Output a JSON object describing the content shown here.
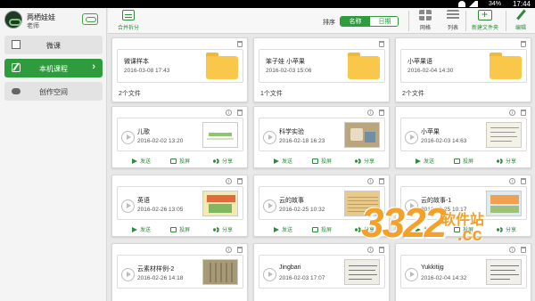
{
  "status_bar": {
    "battery": "34%",
    "time": "17:44"
  },
  "profile": {
    "name": "两栖娃娃",
    "role": "老师"
  },
  "sidebar": {
    "items": [
      {
        "label": "微课",
        "icon": "document-icon",
        "active": false
      },
      {
        "label": "本机课程",
        "icon": "pen-icon",
        "active": true
      },
      {
        "label": "创作空间",
        "icon": "cloud-icon",
        "active": false
      }
    ]
  },
  "toolbar": {
    "merge_label": "合并拆分",
    "sort_label": "排序",
    "sort_options": [
      "名称",
      "日期"
    ],
    "sort_selected": "名称",
    "grid_label": "网格",
    "list_label": "列表",
    "new_folder_label": "新建文件夹",
    "edit_label": "编辑",
    "accent_color": "#2e9b3c"
  },
  "actions": {
    "send": "发送",
    "project": "投屏",
    "share": "分享"
  },
  "folders": [
    {
      "name": "微课样本",
      "date": "2016-03-08 17:43",
      "count": "2个文件"
    },
    {
      "name": "笨子娃 小苹果",
      "date": "2016-02-03 15:06",
      "count": "1个文件"
    },
    {
      "name": "小苹果语",
      "date": "2016-02-04 14:30",
      "count": "2个文件"
    }
  ],
  "files": [
    {
      "name": "儿歌",
      "date": "2016-02-02 13:20"
    },
    {
      "name": "科学实验",
      "date": "2016-02-18 16:23"
    },
    {
      "name": "小苹果",
      "date": "2016-02-03 14:63"
    },
    {
      "name": "英语",
      "date": "2016-02-26 13:05"
    },
    {
      "name": "云的故事",
      "date": "2016-02-25 10:32"
    },
    {
      "name": "云的故事-1",
      "date": "2016-02-25 10:17"
    },
    {
      "name": "云素材样例-2",
      "date": "2016-02-26 14:18"
    },
    {
      "name": "Jingbari",
      "date": "2016-02-03 17:07"
    },
    {
      "name": "Yukkitijg",
      "date": "2016-02-04 14:32"
    }
  ],
  "watermark": {
    "big": "3322",
    "small": "软件站",
    "domain": ".cc"
  }
}
